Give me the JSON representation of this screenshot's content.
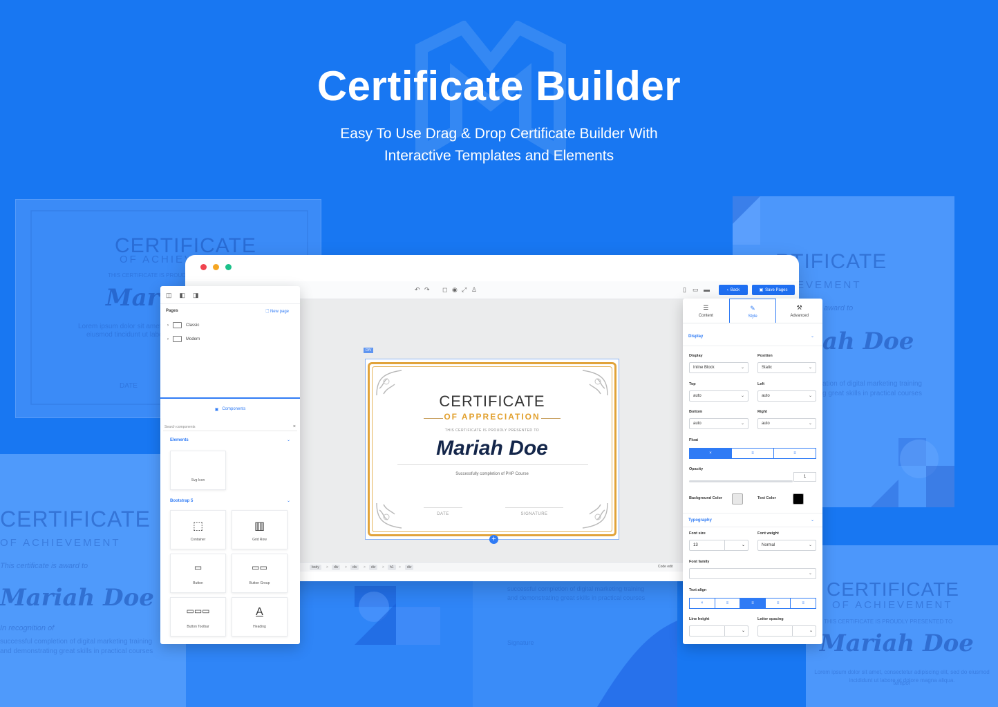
{
  "hero": {
    "title": "Certificate Builder",
    "subtitle_line1": "Easy To Use Drag & Drop Certificate Builder With",
    "subtitle_line2": "Interactive Templates and Elements"
  },
  "background_certificates": {
    "top_left": {
      "title": "CERTIFICATE",
      "subtitle": "OF ACHIEVEMENT",
      "presented": "THIS CERTIFICATE IS PROUDLY",
      "name": "Mari",
      "body1": "Lorem ipsum dolor sit amet, consectetur",
      "body2": "eiusmod tincidunt ut labore",
      "date": "DATE"
    },
    "top_right": {
      "title": "RTIFICATE",
      "subtitle": "HIEVEMENT",
      "award": "award to",
      "name": "ah Doe",
      "body1": "ation of digital marketing training",
      "body2": "g great skills in practical courses"
    },
    "bottom_left": {
      "title": "CERTIFICATE",
      "subtitle": "OF ACHIEVEMENT",
      "award": "This certificate is award to",
      "name": "Mariah Doe",
      "recognition": "In recognition of",
      "body1": "successful completion of digital marketing training",
      "body2": "and demonstrating great skills in practical courses"
    },
    "bottom_middle": {
      "body1": "successful completion of digital marketing training",
      "body2": "and demonstrating great skills in practical courses",
      "signature": "Signature"
    },
    "bottom_right": {
      "title": "CERTIFICATE",
      "subtitle": "OF ACHIEVEMENT",
      "presented": "THIS CERTIFICATE IS PROUDLY PRESENTED TO",
      "name": "Mariah Doe",
      "body1": "Lorem ipsum dolor sit amet, consectetur adipiscing elit, sed do eiusmod tempor",
      "body2": "incididunt ut labore et dolore magna aliqua."
    }
  },
  "editor": {
    "toolbar": {
      "back_label": "Back",
      "save_label": "Save Pages"
    },
    "selected_tag": "DIV",
    "certificate": {
      "title": "CERTIFICATE",
      "subtitle": "OF APPRECIATION",
      "presented": "THIS CERTIFICATE IS PROUDLY PRESENTED TO",
      "recipient": "Mariah Doe",
      "description": "Successfully completion of PHP Course",
      "date_label": "DATE",
      "signature_label": "SIGNATURE"
    },
    "breadcrumbs": [
      "body",
      "div",
      "div",
      "div",
      "h1",
      "div"
    ],
    "code_edit_label": "Code edit"
  },
  "left_panel": {
    "pages_label": "Pages",
    "new_page_label": "New page",
    "pages": [
      "Classic",
      "Modern"
    ],
    "components_tab": "Components",
    "search_placeholder": "Search components",
    "sections": {
      "elements": "Elements",
      "bootstrap": "Bootstrap 5"
    },
    "element_items": [
      "Svg Icon"
    ],
    "bootstrap_items": [
      "Container",
      "Grid Row",
      "Button",
      "Button Group",
      "Button Toolbar",
      "Heading"
    ]
  },
  "right_panel": {
    "tabs": [
      "Content",
      "Style",
      "Advanced"
    ],
    "active_tab": "Style",
    "display_section": "Display",
    "fields": {
      "display": {
        "label": "Display",
        "value": "Inline Block"
      },
      "position": {
        "label": "Position",
        "value": "Static"
      },
      "top": {
        "label": "Top",
        "value": "auto"
      },
      "left": {
        "label": "Left",
        "value": "auto"
      },
      "bottom": {
        "label": "Bottom",
        "value": "auto"
      },
      "right": {
        "label": "Right",
        "value": "auto"
      },
      "float": {
        "label": "Float",
        "options": [
          "×",
          "≡",
          "≡"
        ],
        "selected": 0
      },
      "opacity": {
        "label": "Opacity",
        "value": "1"
      },
      "background_color": {
        "label": "Background Color",
        "value": "#e8e8e8"
      },
      "text_color": {
        "label": "Text Color",
        "value": "#000000"
      }
    },
    "typography_section": "Typography",
    "typography": {
      "font_size": {
        "label": "Font size",
        "value": "13"
      },
      "font_weight": {
        "label": "Font weight",
        "value": "Normal"
      },
      "font_family": {
        "label": "Font family",
        "value": ""
      },
      "text_align": {
        "label": "Text align",
        "options": [
          "×",
          "≡",
          "≡",
          "≡",
          "≡"
        ],
        "selected": 2
      },
      "line_height": {
        "label": "Line height",
        "value": ""
      },
      "letter_spacing": {
        "label": "Letter spacing",
        "value": ""
      }
    }
  },
  "colors": {
    "brand_blue": "#1877f2",
    "accent": "#2f7bf5",
    "gold": "#e1a33a"
  }
}
